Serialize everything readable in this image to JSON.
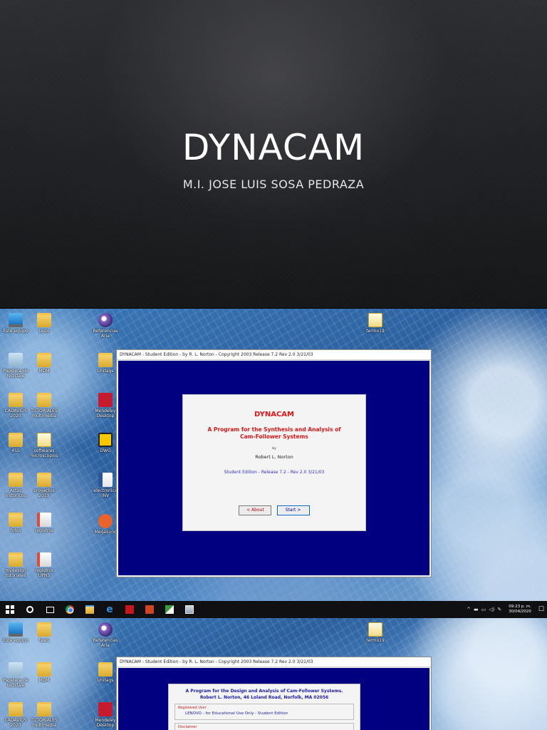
{
  "slide": {
    "title": "DYNACAM",
    "subtitle": "M.I. JOSE LUIS SOSA PEDRAZA"
  },
  "desktop": {
    "icons_left": [
      {
        "label": "Este equipo",
        "icon": "pc-icon"
      },
      {
        "label": "tesis",
        "icon": "folder-icon"
      },
      {
        "label": "Papelera de reciclaje",
        "icon": "recycle-bin-icon"
      },
      {
        "label": "MDM",
        "icon": "folder-icon"
      },
      {
        "label": "CADAVIDS 2020",
        "icon": "folder-icon"
      },
      {
        "label": "TUTORIALES multimedia",
        "icon": "folder-icon"
      },
      {
        "label": "4SS",
        "icon": "folder-icon"
      },
      {
        "label": "softwares microscopios",
        "icon": "folder-icon"
      },
      {
        "label": "Actas historicos",
        "icon": "folder-icon"
      },
      {
        "label": "proyectos 2019",
        "icon": "folder-icon"
      },
      {
        "label": "fotos",
        "icon": "folder-icon"
      },
      {
        "label": "registros",
        "icon": "document-icon"
      },
      {
        "label": "mydesign tutoriales",
        "icon": "folder-icon"
      },
      {
        "label": "registros UPNS",
        "icon": "document-icon"
      }
    ],
    "icons_mid": [
      {
        "label": "Referencias Aria",
        "icon": "eclipse-icon"
      },
      {
        "label": "Unitags",
        "icon": "folder-icon"
      },
      {
        "label": "Mendeley Desktop",
        "icon": "mendeley-icon"
      },
      {
        "label": "DWG",
        "icon": "dwg-icon"
      },
      {
        "label": "electronica INV",
        "icon": "word-icon"
      },
      {
        "label": "MegaSync",
        "icon": "mega-icon"
      }
    ],
    "icon_right": {
      "label": "termo19",
      "icon": "folder-icon"
    }
  },
  "window": {
    "title": "DYNACAM - Student Edition - by R. L. Norton - Copyright 2003   Release 7.2   Rev 2.0   3/21/03"
  },
  "splash": {
    "title": "DYNACAM",
    "subtitle": "A Program for the Synthesis and Analysis of Cam-Follower Systems",
    "by": "by",
    "author": "Robert L. Norton",
    "edition": "Student Edition - Release 7.2 -  Rev 2.0   3/21/03",
    "about_button": "< About",
    "start_button": "Start >"
  },
  "taskbar": {
    "apps": [
      "start-icon",
      "search-icon",
      "task-view-icon",
      "chrome-icon",
      "file-explorer-icon",
      "edge-icon",
      "acrobat-icon",
      "powerpoint-icon",
      "onenote-icon",
      "app-icon"
    ],
    "time": "09:23 p. m.",
    "date": "30/04/2020"
  },
  "about": {
    "title_line1": "A Program for the Design and Analysis of Cam-Follower Systems.",
    "title_line2": "Robert L. Norton, 46 Loland Road, Norfolk, MA 02056",
    "registered_label": "Registered User",
    "registered_value": "LENOVO  - for Educational Use Only - Student Edition",
    "disclaimer_label": "Disclaimer"
  },
  "colors": {
    "app_client": "#000080",
    "splash_red": "#e01515",
    "edition_blue": "#3030d0",
    "taskbar": "#101012"
  }
}
